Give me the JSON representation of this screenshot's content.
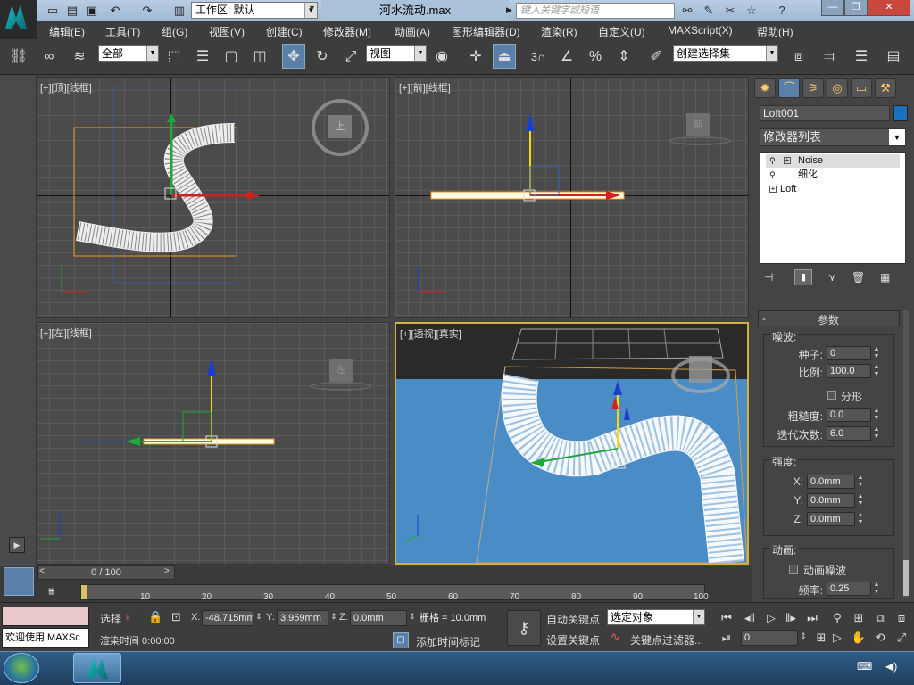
{
  "titlebar": {
    "workspace": "工作区: 默认",
    "filename": "河水流动.max",
    "search_placeholder": "键入关键字或短语"
  },
  "menu": [
    "编辑(E)",
    "工具(T)",
    "组(G)",
    "视图(V)",
    "创建(C)",
    "修改器(M)",
    "动画(A)",
    "图形编辑器(D)",
    "渲染(R)",
    "自定义(U)",
    "MAXScript(X)",
    "帮助(H)"
  ],
  "toolbar": {
    "filter": "全部",
    "coord": "视图",
    "selection_set": "创建选择集",
    "snap_label": "3"
  },
  "viewports": {
    "top": "[+][顶][线框]",
    "front": "[+][前][线框]",
    "left": "[+][左][线框]",
    "persp": "[+][透视][真实]",
    "cube_top": "上",
    "cube_front": "前",
    "cube_left": "左"
  },
  "panel": {
    "object_name": "Loft001",
    "object_color": "#1c70c0",
    "modifier_list": "修改器列表",
    "stack": [
      "Noise",
      "细化",
      "Loft"
    ],
    "params_title": "参数",
    "noise_group": "噪波:",
    "seed_label": "种子:",
    "seed": "0",
    "scale_label": "比例:",
    "scale": "100.0",
    "fractal_label": "分形",
    "roughness_label": "粗糙度:",
    "roughness": "0.0",
    "iterations_label": "迭代次数:",
    "iterations": "6.0",
    "strength_group": "强度:",
    "x_label": "X:",
    "x": "0.0mm",
    "y_label": "Y:",
    "y": "0.0mm",
    "z_label": "Z:",
    "z": "0.0mm",
    "anim_group": "动画:",
    "anim_noise_label": "动画噪波",
    "freq_label": "频率:",
    "freq": "0.25"
  },
  "timeline": {
    "frame": "0 / 100",
    "ticks": [
      "10",
      "20",
      "30",
      "40",
      "50",
      "60",
      "70",
      "80",
      "90",
      "100"
    ]
  },
  "status": {
    "welcome": "欢迎使用 MAXSc",
    "sel_label": "选择",
    "x": "-48.715mm",
    "y": "3.959mm",
    "z": "0.0mm",
    "grid": "栅格 = 10.0mm",
    "auto_key": "自动关键点",
    "set_key": "设置关键点",
    "selected": "选定对象",
    "key_filter": "关键点过滤器...",
    "render_time": "渲染时间  0:00:00",
    "add_tag": "添加时间标记",
    "frame_field": "0"
  }
}
